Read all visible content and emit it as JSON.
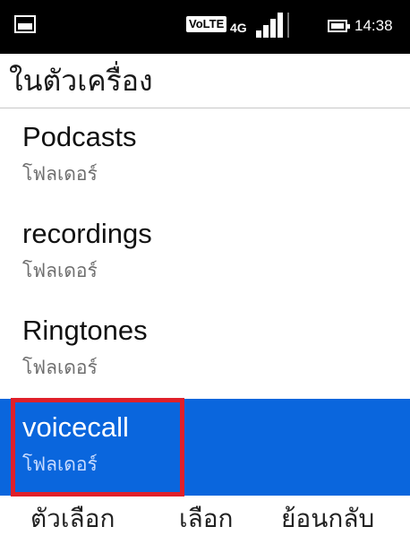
{
  "status_bar": {
    "network_badge": "VoLTE",
    "network_type": "4G",
    "time": "14:38",
    "icons": [
      "picture-icon",
      "signal-icon",
      "battery-icon"
    ]
  },
  "title": "ในตัวเครื่อง",
  "items": [
    {
      "name": "Podcasts",
      "type": "โฟลเดอร์",
      "selected": false
    },
    {
      "name": "recordings",
      "type": "โฟลเดอร์",
      "selected": false
    },
    {
      "name": "Ringtones",
      "type": "โฟลเดอร์",
      "selected": false
    },
    {
      "name": "voicecall",
      "type": "โฟลเดอร์",
      "selected": true
    }
  ],
  "softkeys": {
    "left": "ตัวเลือก",
    "center": "เลือก",
    "right": "ย้อนกลับ"
  },
  "colors": {
    "status_bar_bg": "#000000",
    "selection_bg": "#0a66dd",
    "highlight_border": "#e0202a"
  }
}
